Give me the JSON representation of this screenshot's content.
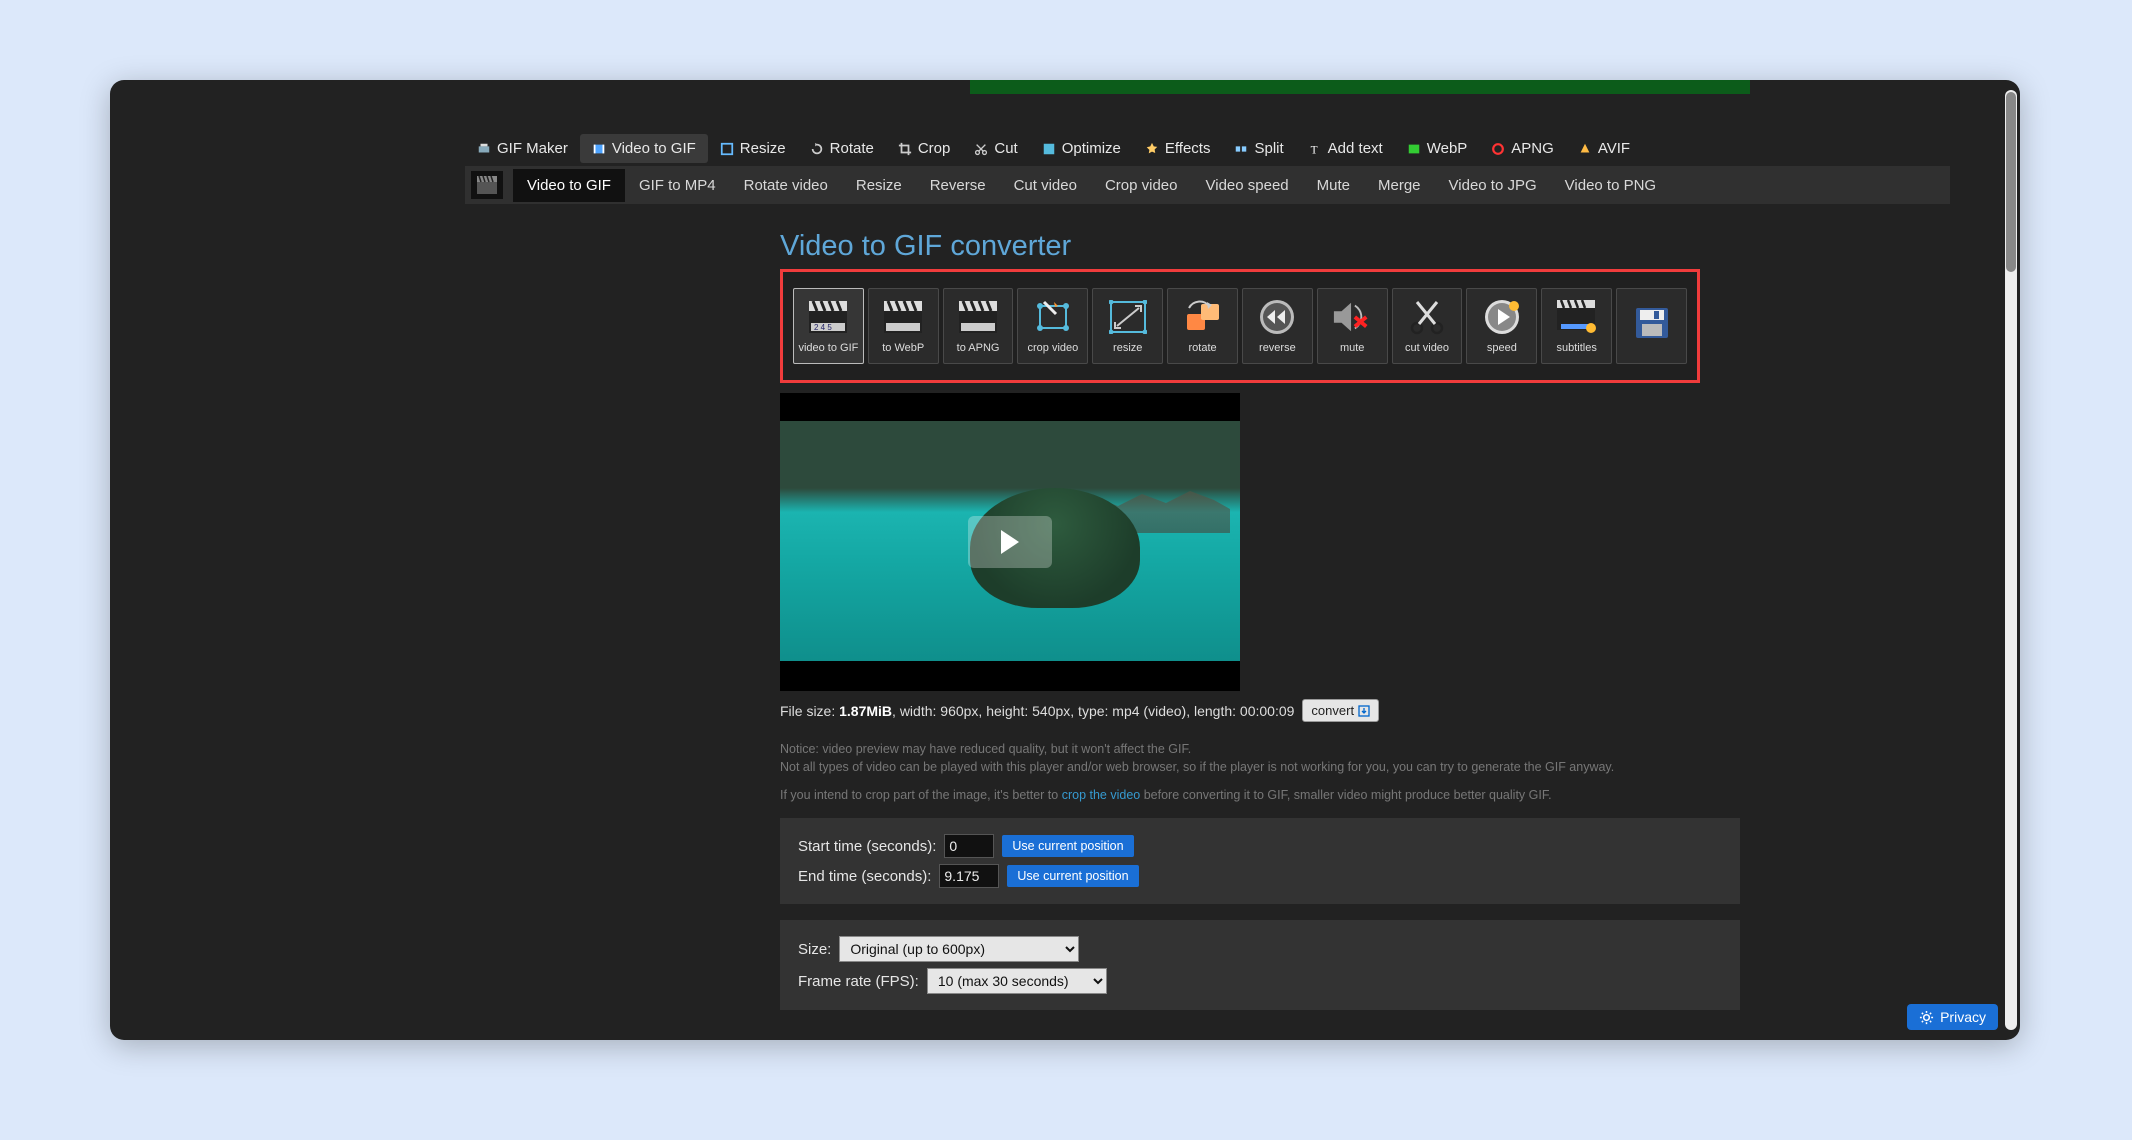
{
  "topnav": [
    {
      "label": "GIF Maker"
    },
    {
      "label": "Video to GIF",
      "active": true
    },
    {
      "label": "Resize"
    },
    {
      "label": "Rotate"
    },
    {
      "label": "Crop"
    },
    {
      "label": "Cut"
    },
    {
      "label": "Optimize"
    },
    {
      "label": "Effects"
    },
    {
      "label": "Split"
    },
    {
      "label": "Add text"
    },
    {
      "label": "WebP"
    },
    {
      "label": "APNG"
    },
    {
      "label": "AVIF"
    }
  ],
  "subnav": [
    {
      "label": "Video to GIF",
      "active": true
    },
    {
      "label": "GIF to MP4"
    },
    {
      "label": "Rotate video"
    },
    {
      "label": "Resize"
    },
    {
      "label": "Reverse"
    },
    {
      "label": "Cut video"
    },
    {
      "label": "Crop video"
    },
    {
      "label": "Video speed"
    },
    {
      "label": "Mute"
    },
    {
      "label": "Merge"
    },
    {
      "label": "Video to JPG"
    },
    {
      "label": "Video to PNG"
    }
  ],
  "page_title": "Video to GIF converter",
  "tools": [
    {
      "label": "video to GIF",
      "active": true
    },
    {
      "label": "to WebP"
    },
    {
      "label": "to APNG"
    },
    {
      "label": "crop video"
    },
    {
      "label": "resize"
    },
    {
      "label": "rotate"
    },
    {
      "label": "reverse"
    },
    {
      "label": "mute"
    },
    {
      "label": "cut video"
    },
    {
      "label": "speed"
    },
    {
      "label": "subtitles"
    },
    {
      "label": ""
    }
  ],
  "fileinfo": {
    "prefix": "File size: ",
    "size": "1.87MiB",
    "rest": ", width: 960px, height: 540px, type: mp4 (video), length: 00:00:09",
    "convert": "convert"
  },
  "notice": {
    "line1": "Notice: video preview may have reduced quality, but it won't affect the GIF.",
    "line2": "Not all types of video can be played with this player and/or web browser, so if the player is not working for you, you can try to generate the GIF anyway.",
    "line3a": "If you intend to crop part of the image, it's better to ",
    "link": "crop the video",
    "line3b": " before converting it to GIF, smaller video might produce better quality GIF."
  },
  "time_panel": {
    "start_label": "Start time (seconds):",
    "start_value": "0",
    "end_label": "End time (seconds):",
    "end_value": "9.175",
    "use_current": "Use current position"
  },
  "settings_panel": {
    "size_label": "Size:",
    "size_value": "Original (up to 600px)",
    "fps_label": "Frame rate (FPS):",
    "fps_value": "10 (max 30 seconds)"
  },
  "privacy": "Privacy"
}
